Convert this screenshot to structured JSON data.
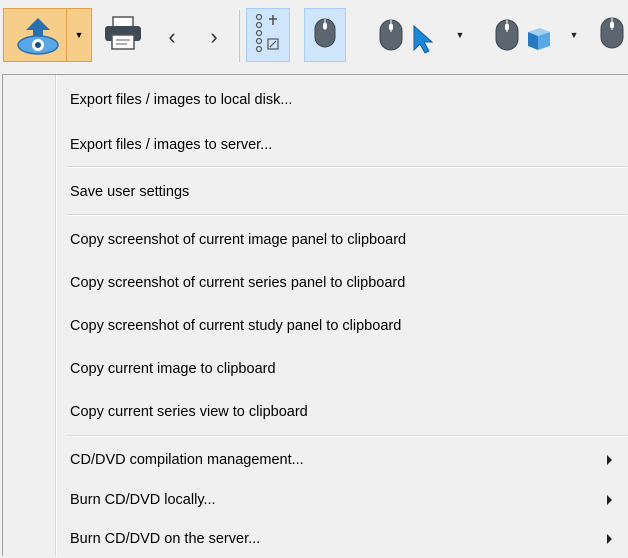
{
  "toolbar": {
    "buttons": [
      {
        "name": "export-button",
        "icon": "export-eye-icon",
        "has_dropdown": true,
        "state": "pressed"
      },
      {
        "name": "print-button",
        "icon": "printer-icon"
      },
      {
        "name": "previous-button",
        "icon": "chevron-left-icon",
        "glyph": "‹"
      },
      {
        "name": "next-button",
        "icon": "chevron-right-icon",
        "glyph": "›"
      },
      {
        "name": "viewport-layout-button",
        "icon": "layout-grid-icon",
        "state": "active"
      },
      {
        "name": "mouse-select-button",
        "icon": "mouse-icon",
        "state": "active"
      },
      {
        "name": "mouse-pointer-button",
        "icon": "mouse-arrow-icon",
        "has_dropdown": true
      },
      {
        "name": "mouse-3d-button",
        "icon": "mouse-cube-icon",
        "has_dropdown": true
      },
      {
        "name": "mouse-more-button",
        "icon": "mouse-icon"
      }
    ],
    "accent_color": "#f6ce8a",
    "active_color": "#cfe5fb"
  },
  "menu": {
    "groups": [
      [
        {
          "label": "Export files / images to local disk...",
          "submenu": false
        },
        {
          "label": "Export files / images to server...",
          "submenu": false
        }
      ],
      [
        {
          "label": "Save user settings",
          "submenu": false
        }
      ],
      [
        {
          "label": "Copy screenshot of current image panel to clipboard",
          "submenu": false
        },
        {
          "label": "Copy screenshot of current series panel to clipboard",
          "submenu": false
        },
        {
          "label": "Copy screenshot of current study panel to clipboard",
          "submenu": false
        },
        {
          "label": "Copy current image to clipboard",
          "submenu": false
        },
        {
          "label": "Copy current series view to clipboard",
          "submenu": false
        }
      ],
      [
        {
          "label": "CD/DVD compilation management...",
          "submenu": true
        },
        {
          "label": "Burn CD/DVD locally...",
          "submenu": true
        },
        {
          "label": "Burn CD/DVD on the server...",
          "submenu": true
        }
      ]
    ]
  }
}
